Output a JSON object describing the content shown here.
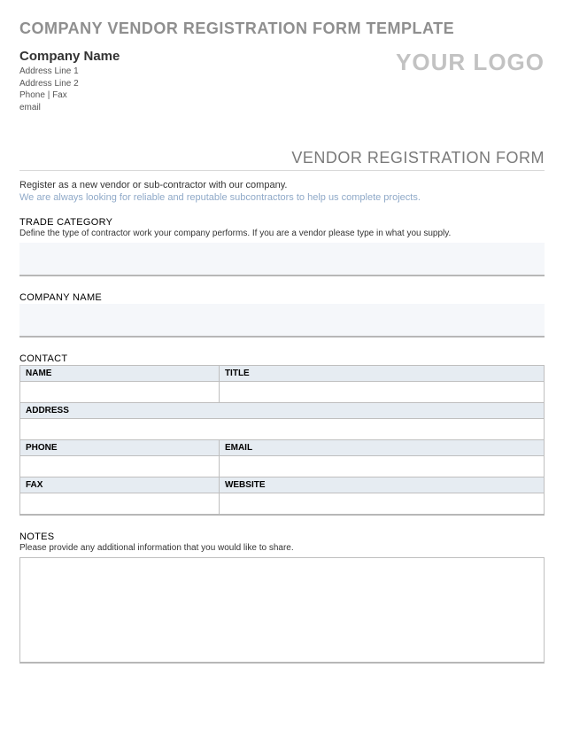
{
  "page_title": "COMPANY VENDOR REGISTRATION FORM TEMPLATE",
  "company": {
    "name": "Company Name",
    "address1": "Address Line 1",
    "address2": "Address Line 2",
    "phone_fax": "Phone | Fax",
    "email": "email"
  },
  "logo_text": "YOUR LOGO",
  "form_title": "VENDOR REGISTRATION FORM",
  "intro": {
    "line1": "Register as a new vendor or sub-contractor with our company.",
    "line2": "We are always looking for reliable and reputable subcontractors to help us complete projects."
  },
  "trade": {
    "label": "TRADE CATEGORY",
    "help": "Define the type of contractor work your company performs. If you are a vendor please type in what you supply.",
    "value": ""
  },
  "company_name_field": {
    "label": "COMPANY NAME",
    "value": ""
  },
  "contact": {
    "label": "CONTACT",
    "fields": {
      "name": "NAME",
      "title": "TITLE",
      "address": "ADDRESS",
      "phone": "PHONE",
      "email": "EMAIL",
      "fax": "FAX",
      "website": "WEBSITE"
    },
    "values": {
      "name": "",
      "title": "",
      "address": "",
      "phone": "",
      "email": "",
      "fax": "",
      "website": ""
    }
  },
  "notes": {
    "label": "NOTES",
    "help": "Please provide any additional information that you would like to share.",
    "value": ""
  }
}
